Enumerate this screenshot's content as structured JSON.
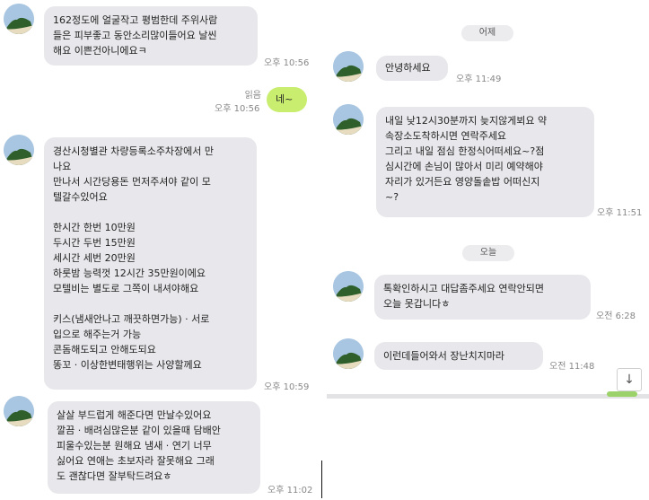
{
  "left": {
    "messages": [
      {
        "text": "162정도에 얼굴작고 평범한데 주위사람\n들은 피부좋고 동안소리많이들어요 날씬\n해요 이쁜건아니에요ㅋ",
        "time": "오후 10:56"
      },
      {
        "text": "네~",
        "time": "오후 10:56",
        "read": "읽음"
      },
      {
        "text": "경산시청별관 차량등록소주차장에서 만\n나요\n만나서 시간당용돈 먼저주셔야 같이 모\n텔갈수있어요\n\n한시간 한번 10만원\n두시간 두번 15만원\n세시간 세번 20만원\n하룻밤 능력껏 12시간 35만원이에요\n모텔비는 별도로 그쪽이 내셔야해요\n\n키스(냄새안나고 깨끗하면가능) · 서로\n입으로 해주는거 가능\n콘돔해도되고 안해도되요\n똥꼬 · 이상한변태행위는 사양할께요",
        "time": "오후 10:59"
      },
      {
        "text": "살살 부드럽게 해준다면 만날수있어요\n깔끔 · 배려심많은분 같이 있을때 담배안\n피울수있는분 원해요 냄새 · 연기 너무\n싫어요 연애는 초보자라 잘못해요 그래\n도 괜찮다면 잘부탁드려요ㅎ",
        "time": "오후 11:02"
      }
    ]
  },
  "right": {
    "date_yesterday": "어제",
    "date_today": "오늘",
    "messages": [
      {
        "text": "안녕하세요",
        "time": "오후 11:49"
      },
      {
        "text": "내일 낮12시30분까지 늦지않게뵈요 약\n속장소도착하시면 연락주세요\n그리고 내일 점심 한정식어떠세요~?점\n심시간에 손님이 많아서 미리 예약해야\n자리가 있거든요 영양돌솥밥 어떠신지\n~?",
        "time": "오후 11:51"
      },
      {
        "text": "톡확인하시고 대답좀주세요 연락안되면\n오늘 못갑니다ㅎ",
        "time": "오전 6:28"
      },
      {
        "text": "이런데들어와서  장난치지마라",
        "time": "오전 11:48"
      }
    ],
    "scroll_down_icon": "arrow-down-icon"
  }
}
